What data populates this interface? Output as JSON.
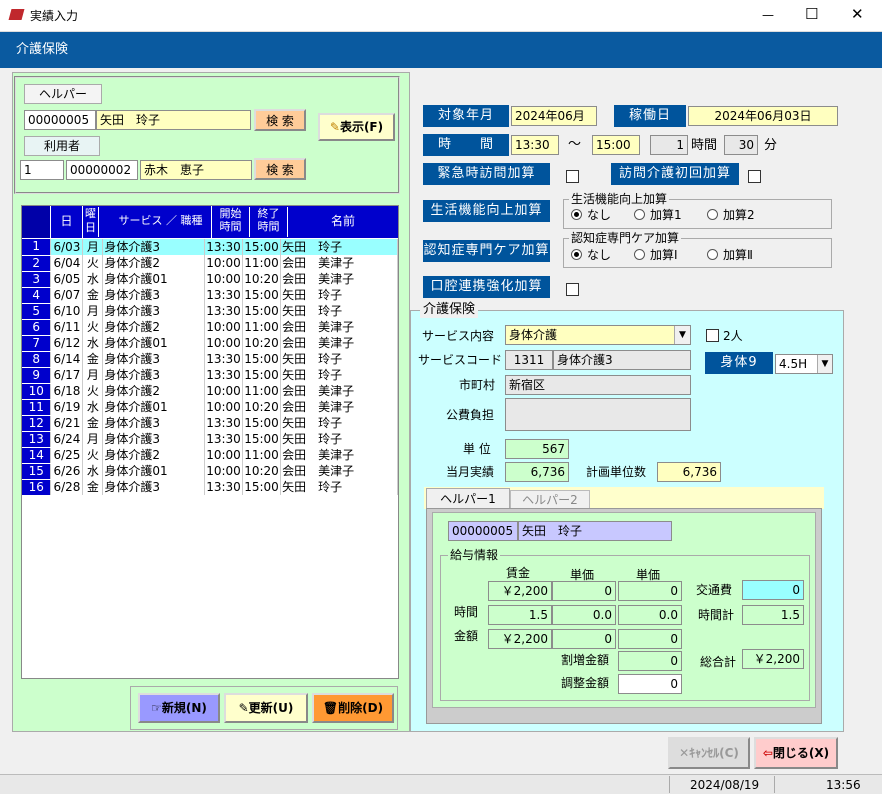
{
  "window": {
    "title": "実績入力",
    "min": "—",
    "max": "☐",
    "close": "✕"
  },
  "banner": {
    "title": "介護保険"
  },
  "helper": {
    "label": "ヘルパー",
    "id": "00000005",
    "name": "矢田　玲子",
    "search": "検 索"
  },
  "user": {
    "label": "利用者",
    "no": "1",
    "id": "00000002",
    "name": "赤木　恵子",
    "search": "検 索"
  },
  "show_button": "表示(F)",
  "table": {
    "headers": [
      "日",
      "曜日",
      "サービス ／ 職種",
      "開始時間",
      "終了時間",
      "名前"
    ],
    "rows": [
      {
        "n": "1",
        "d": "6/03",
        "w": "月",
        "s": "身体介護3",
        "a": "13:30",
        "b": "15:00",
        "nm": "矢田　玲子"
      },
      {
        "n": "2",
        "d": "6/04",
        "w": "火",
        "s": "身体介護2",
        "a": "10:00",
        "b": "11:00",
        "nm": "会田　美津子"
      },
      {
        "n": "3",
        "d": "6/05",
        "w": "水",
        "s": "身体介護01",
        "a": "10:00",
        "b": "10:20",
        "nm": "会田　美津子"
      },
      {
        "n": "4",
        "d": "6/07",
        "w": "金",
        "s": "身体介護3",
        "a": "13:30",
        "b": "15:00",
        "nm": "矢田　玲子"
      },
      {
        "n": "5",
        "d": "6/10",
        "w": "月",
        "s": "身体介護3",
        "a": "13:30",
        "b": "15:00",
        "nm": "矢田　玲子"
      },
      {
        "n": "6",
        "d": "6/11",
        "w": "火",
        "s": "身体介護2",
        "a": "10:00",
        "b": "11:00",
        "nm": "会田　美津子"
      },
      {
        "n": "7",
        "d": "6/12",
        "w": "水",
        "s": "身体介護01",
        "a": "10:00",
        "b": "10:20",
        "nm": "会田　美津子"
      },
      {
        "n": "8",
        "d": "6/14",
        "w": "金",
        "s": "身体介護3",
        "a": "13:30",
        "b": "15:00",
        "nm": "矢田　玲子"
      },
      {
        "n": "9",
        "d": "6/17",
        "w": "月",
        "s": "身体介護3",
        "a": "13:30",
        "b": "15:00",
        "nm": "矢田　玲子"
      },
      {
        "n": "10",
        "d": "6/18",
        "w": "火",
        "s": "身体介護2",
        "a": "10:00",
        "b": "11:00",
        "nm": "会田　美津子"
      },
      {
        "n": "11",
        "d": "6/19",
        "w": "水",
        "s": "身体介護01",
        "a": "10:00",
        "b": "10:20",
        "nm": "会田　美津子"
      },
      {
        "n": "12",
        "d": "6/21",
        "w": "金",
        "s": "身体介護3",
        "a": "13:30",
        "b": "15:00",
        "nm": "矢田　玲子"
      },
      {
        "n": "13",
        "d": "6/24",
        "w": "月",
        "s": "身体介護3",
        "a": "13:30",
        "b": "15:00",
        "nm": "矢田　玲子"
      },
      {
        "n": "14",
        "d": "6/25",
        "w": "火",
        "s": "身体介護2",
        "a": "10:00",
        "b": "11:00",
        "nm": "会田　美津子"
      },
      {
        "n": "15",
        "d": "6/26",
        "w": "水",
        "s": "身体介護01",
        "a": "10:00",
        "b": "10:20",
        "nm": "会田　美津子"
      },
      {
        "n": "16",
        "d": "6/28",
        "w": "金",
        "s": "身体介護3",
        "a": "13:30",
        "b": "15:00",
        "nm": "矢田　玲子"
      }
    ]
  },
  "buttons": {
    "new": "新規(N)",
    "update": "更新(U)",
    "delete": "削除(D)",
    "cancel": "ｷｬﾝｾﾙ(C)",
    "close": "閉じる(X)"
  },
  "right": {
    "target_label": "対象年月",
    "target_value": "2024年06月",
    "work_label": "稼働日",
    "work_value": "2024年06月03日",
    "time_label": "時　　間",
    "start": "13:30",
    "tilde": "～",
    "end": "15:00",
    "hours": "1",
    "hours_unit": "時間",
    "minutes": "30",
    "minutes_unit": "分",
    "emergency": "緊急時訪問加算",
    "initial": "訪問介護初回加算",
    "life_btn": "生活機能向上加算",
    "life_group": "生活機能向上加算",
    "life_opts": [
      "なし",
      "加算1",
      "加算2"
    ],
    "dementia_btn": "認知症専門ケア加算",
    "dementia_group": "認知症専門ケア加算",
    "dementia_opts": [
      "なし",
      "加算Ⅰ",
      "加算Ⅱ"
    ],
    "oral": "口腔連携強化加算"
  },
  "kaigo": {
    "group": "介護保険",
    "content_label": "サービス内容",
    "content_value": "身体介護",
    "two_person": "2人",
    "code_label": "サービスコード",
    "code": "1311",
    "code_name": "身体介護3",
    "body_btn": "身体9",
    "body_value": "4.5H",
    "city_label": "市町村",
    "city_value": "新宿区",
    "public_label": "公費負担",
    "unit_label": "単 位",
    "unit_value": "567",
    "month_label": "当月実績",
    "month_value": "6,736",
    "plan_label": "計画単位数",
    "plan_value": "6,736"
  },
  "tabs": [
    "ヘルパー1",
    "ヘルパー2"
  ],
  "tab_panel": {
    "helper_id": "00000005",
    "helper_name": "矢田　玲子",
    "salary_group": "給与情報",
    "col_headers": [
      "賃金",
      "単価",
      "単価"
    ],
    "row1": [
      "￥2,200",
      "0",
      "0"
    ],
    "time_label": "時間",
    "time_row": [
      "1.5",
      "0.0",
      "0.0"
    ],
    "amount_label": "金額",
    "amount_row": [
      "￥2,200",
      "0",
      "0"
    ],
    "transport_label": "交通費",
    "transport_value": "0",
    "time_total_label": "時間計",
    "time_total_value": "1.5",
    "surcharge_label": "割増金額",
    "surcharge_value": "0",
    "grand_label": "総合計",
    "grand_value": "￥2,200",
    "adjust_label": "調整金額",
    "adjust_value": "0"
  },
  "status": {
    "date": "2024/08/19",
    "time": "13:56"
  }
}
